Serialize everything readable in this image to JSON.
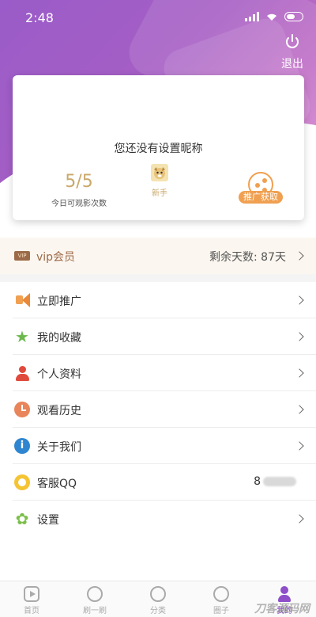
{
  "status": {
    "time": "2:48"
  },
  "header": {
    "logout_label": "退出"
  },
  "profile": {
    "nickname_prompt": "您还没有设置昵称",
    "views": "5/5",
    "views_caption": "今日可观影次数",
    "level": "新手",
    "promo_button": "推广获取"
  },
  "vip": {
    "tag": "VIP",
    "label": "vip会员",
    "remaining": "剩余天数: 87天"
  },
  "menu": [
    {
      "label": "立即推广",
      "icon": "megaphone-icon"
    },
    {
      "label": "我的收藏",
      "icon": "star-icon"
    },
    {
      "label": "个人资料",
      "icon": "person-icon"
    },
    {
      "label": "观看历史",
      "icon": "clock-icon"
    },
    {
      "label": "关于我们",
      "icon": "info-icon"
    },
    {
      "label": "客服QQ",
      "icon": "qq-icon",
      "value": "8"
    },
    {
      "label": "设置",
      "icon": "gear-icon"
    }
  ],
  "tabs": [
    {
      "label": "首页"
    },
    {
      "label": "刷一刷"
    },
    {
      "label": "分类"
    },
    {
      "label": "圈子"
    },
    {
      "label": "我的"
    }
  ],
  "watermark": "刀客源码网",
  "colors": {
    "accent": "#8e4fc9",
    "gold": "#c9a86a",
    "orange": "#f0a050"
  }
}
